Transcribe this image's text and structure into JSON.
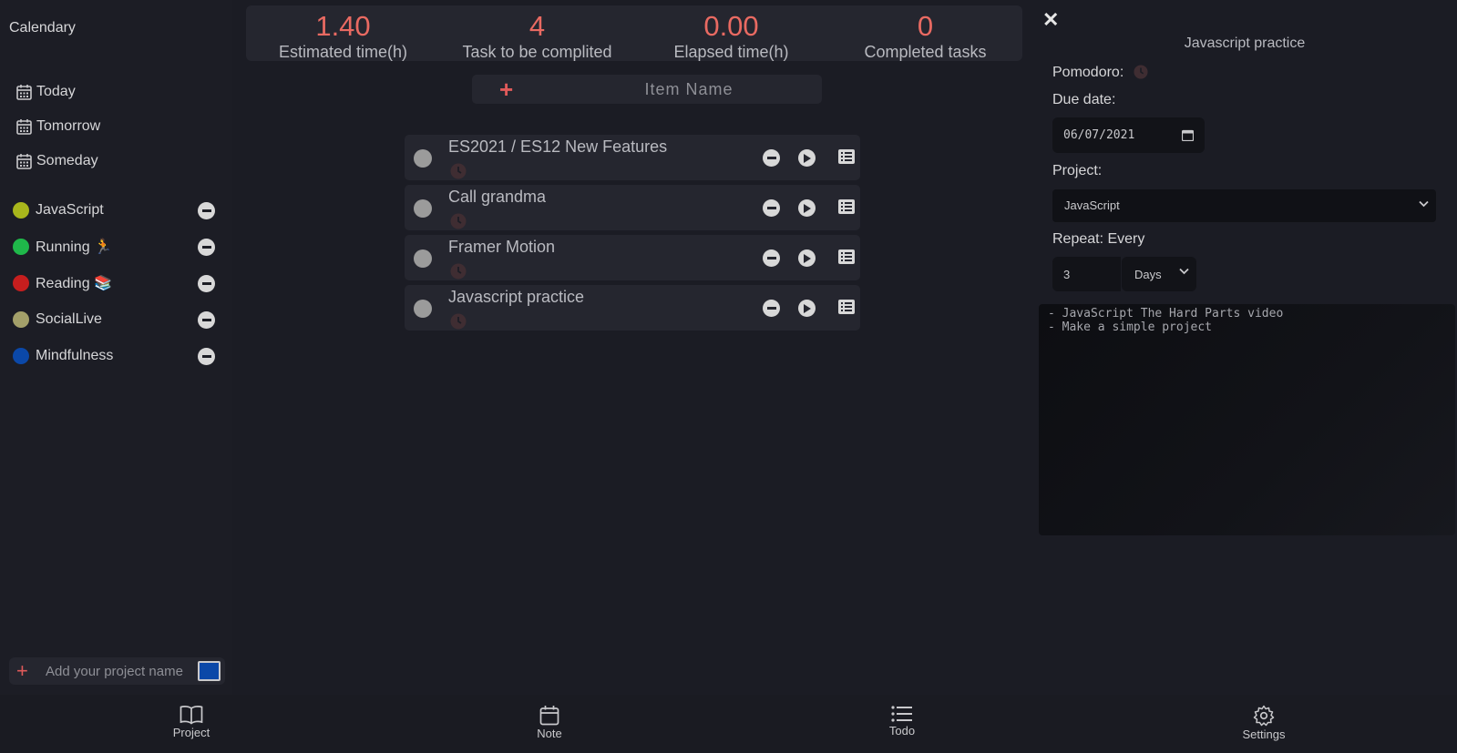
{
  "sidebar": {
    "title": "Calendary",
    "nav": [
      {
        "label": "Today",
        "icon": "calendar-icon"
      },
      {
        "label": "Tomorrow",
        "icon": "calendar-icon"
      },
      {
        "label": "Someday",
        "icon": "calendar-icon"
      }
    ],
    "projects": [
      {
        "label": "JavaScript",
        "color": "#a8b61c"
      },
      {
        "label": "Running 🏃",
        "color": "#1fb84a"
      },
      {
        "label": "Reading 📚",
        "color": "#c61e1e"
      },
      {
        "label": "SocialLive",
        "color": "#a3a06a"
      },
      {
        "label": "Mindfulness",
        "color": "#0b48a8"
      }
    ],
    "add_project": {
      "placeholder": "Add  your project name",
      "color": "#0b48a8"
    }
  },
  "stats": [
    {
      "value": "1.40",
      "label": "Estimated time(h)"
    },
    {
      "value": "4",
      "label": "Task to be complited"
    },
    {
      "value": "0.00",
      "label": "Elapsed time(h)"
    },
    {
      "value": "0",
      "label": "Completed tasks"
    }
  ],
  "add_item": {
    "placeholder": "Item Name"
  },
  "tasks": [
    {
      "name": "ES2021 / ES12 New Features"
    },
    {
      "name": "Call grandma"
    },
    {
      "name": "Framer Motion"
    },
    {
      "name": "Javascript practice"
    }
  ],
  "detail": {
    "title": "Javascript practice",
    "pomodoro_label": "Pomodoro:",
    "due_label": "Due date:",
    "due_value": "06/07/2021",
    "project_label": "Project:",
    "project_value": "JavaScript",
    "repeat_label": "Repeat: Every",
    "repeat_count": "3",
    "repeat_unit": "Days",
    "notes": "- JavaScript The Hard Parts video\n- Make a simple project"
  },
  "bottom_nav": [
    {
      "label": "Project",
      "icon": "book-icon"
    },
    {
      "label": "Note",
      "icon": "calendar-icon"
    },
    {
      "label": "Todo",
      "icon": "list-icon"
    },
    {
      "label": "Settings",
      "icon": "gear-icon"
    }
  ],
  "colors": {
    "accent": "#e96a62",
    "panel": "#25262f",
    "background": "#1b1c24"
  }
}
